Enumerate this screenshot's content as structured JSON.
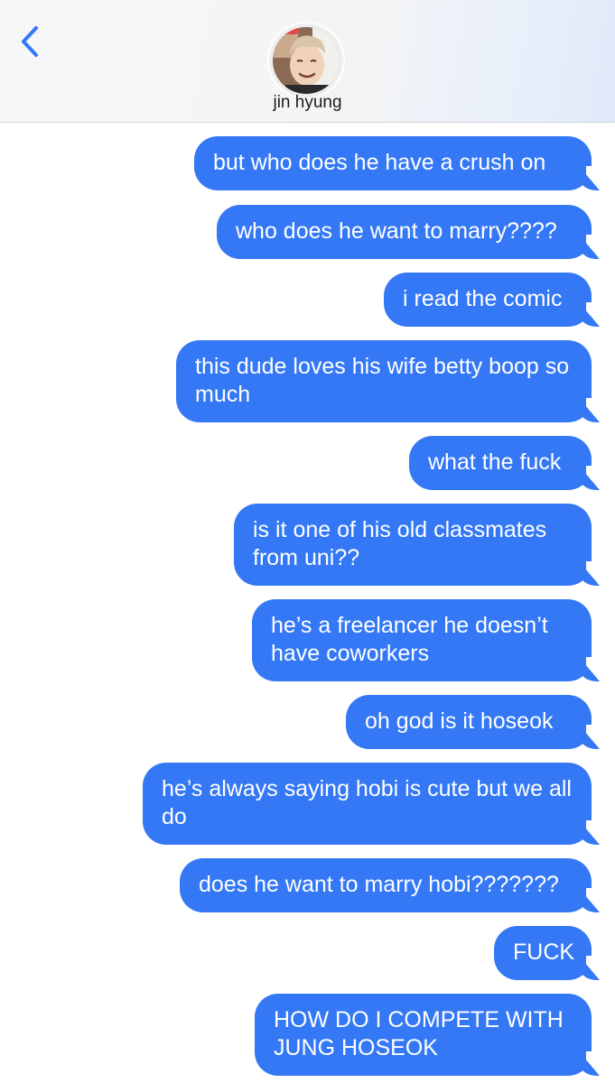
{
  "header": {
    "contact_name": "jin hyung",
    "back_icon": "chevron-left-icon",
    "accent_color": "#3478f6"
  },
  "messages": [
    {
      "text": "but who does he have a crush on",
      "w": 0
    },
    {
      "text": "who does he want to marry????"
    },
    {
      "text": "i read the comic"
    },
    {
      "text": "this dude loves his wife betty boop so much"
    },
    {
      "text": "what the fuck"
    },
    {
      "text": "is it one of his old classmates from uni??"
    },
    {
      "text": "he’s a freelancer he doesn’t have coworkers"
    },
    {
      "text": "oh god is it hoseok"
    },
    {
      "text": "he’s always saying hobi is cute but we all do"
    },
    {
      "text": "does he want to marry hobi???????"
    },
    {
      "text": "FUCK"
    },
    {
      "text": "HOW DO I COMPETE WITH JUNG HOSEOK"
    }
  ],
  "bubble_color": "#3478f6"
}
